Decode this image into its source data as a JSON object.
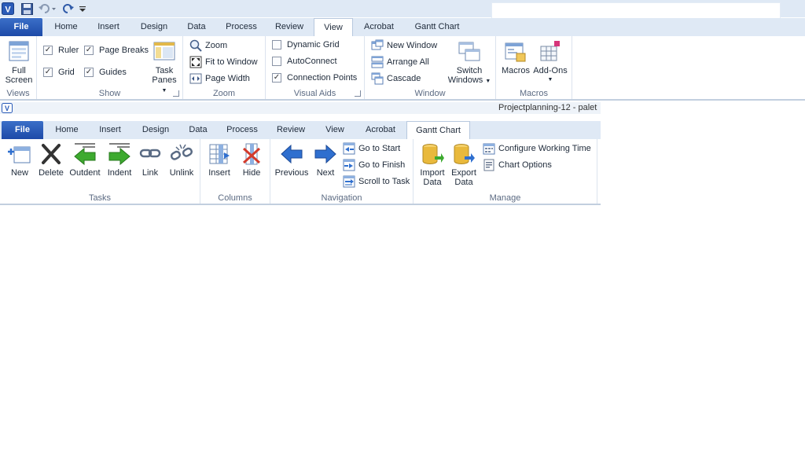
{
  "top_ribbon": {
    "tabs": [
      {
        "label": "File"
      },
      {
        "label": "Home"
      },
      {
        "label": "Insert"
      },
      {
        "label": "Design"
      },
      {
        "label": "Data"
      },
      {
        "label": "Process"
      },
      {
        "label": "Review"
      },
      {
        "label": "View"
      },
      {
        "label": "Acrobat"
      },
      {
        "label": "Gantt Chart"
      }
    ],
    "views": {
      "label": "Views",
      "full_screen_line1": "Full",
      "full_screen_line2": "Screen"
    },
    "show": {
      "label": "Show",
      "ruler": "Ruler",
      "page_breaks": "Page Breaks",
      "grid": "Grid",
      "guides": "Guides",
      "task_panes_line1": "Task",
      "task_panes_line2": "Panes"
    },
    "zoom": {
      "label": "Zoom",
      "zoom": "Zoom",
      "fit_to_window": "Fit to Window",
      "page_width": "Page Width"
    },
    "visual_aids": {
      "label": "Visual Aids",
      "dynamic_grid": "Dynamic Grid",
      "autoconnect": "AutoConnect",
      "connection_points": "Connection Points"
    },
    "window": {
      "label": "Window",
      "new_window": "New Window",
      "arrange_all": "Arrange All",
      "cascade": "Cascade",
      "switch_windows_line1": "Switch",
      "switch_windows_line2": "Windows"
    },
    "macros": {
      "label": "Macros",
      "macros": "Macros",
      "add_ons": "Add-Ons"
    }
  },
  "partial_title": "Projectplanning-12 - palet",
  "bottom_ribbon": {
    "tabs": [
      {
        "label": "File"
      },
      {
        "label": "Home"
      },
      {
        "label": "Insert"
      },
      {
        "label": "Design"
      },
      {
        "label": "Data"
      },
      {
        "label": "Process"
      },
      {
        "label": "Review"
      },
      {
        "label": "View"
      },
      {
        "label": "Acrobat"
      },
      {
        "label": "Gantt Chart"
      }
    ],
    "tasks": {
      "label": "Tasks",
      "new": "New",
      "delete": "Delete",
      "outdent": "Outdent",
      "indent": "Indent",
      "link": "Link",
      "unlink": "Unlink"
    },
    "columns": {
      "label": "Columns",
      "insert": "Insert",
      "hide": "Hide"
    },
    "navigation": {
      "label": "Navigation",
      "previous": "Previous",
      "next": "Next",
      "go_to_start": "Go to Start",
      "go_to_finish": "Go to Finish",
      "scroll_to_task": "Scroll to Task"
    },
    "manage": {
      "label": "Manage",
      "import_line1": "Import",
      "import_line2": "Data",
      "export_line1": "Export",
      "export_line2": "Data",
      "configure_working_time": "Configure Working Time",
      "chart_options": "Chart Options"
    }
  },
  "colors": {
    "file_tab": "#2a5bb8",
    "tab_bar": "#dfe9f5",
    "arrow_green": "#3daa2f",
    "arrow_blue": "#2f6fcf"
  }
}
